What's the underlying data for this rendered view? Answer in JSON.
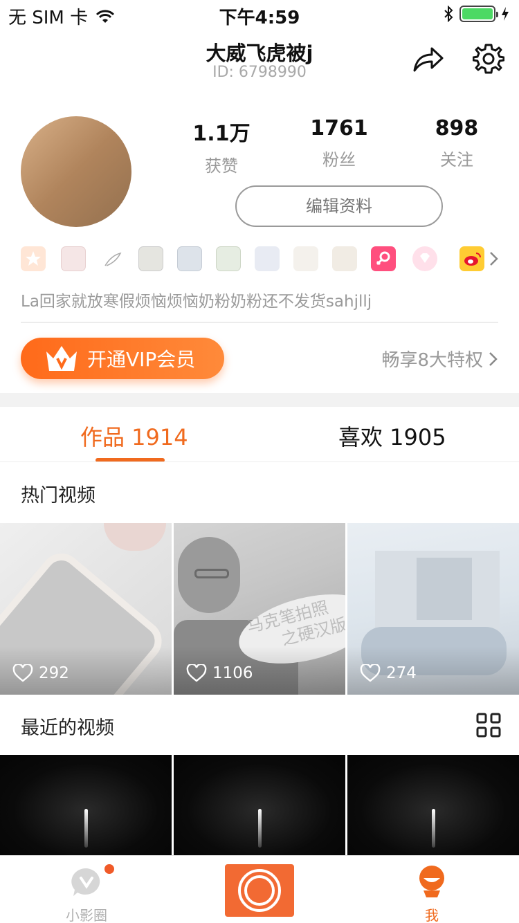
{
  "status_bar": {
    "carrier": "无 SIM 卡",
    "time": "下午4:59"
  },
  "profile": {
    "name": "大威飞虎被j",
    "id": "ID: 6798990",
    "stats": [
      {
        "value": "1.1万",
        "label": "获赞"
      },
      {
        "value": "1761",
        "label": "粉丝"
      },
      {
        "value": "898",
        "label": "关注"
      }
    ],
    "edit_label": "编辑资料",
    "bio": "La回家就放寒假烦恼烦恼奶粉奶粉还不发货sahjllj",
    "badges": [
      "star-badge",
      "sticker-badge",
      "feather-badge",
      "sticker-badge",
      "sticker-badge",
      "sticker-badge",
      "cartoon-badge",
      "sketch-badge",
      "text-badge",
      "female-badge",
      "diamond-badge",
      "weibo-badge"
    ]
  },
  "vip": {
    "button_label": "开通VIP会员",
    "privilege_label": "畅享8大特权"
  },
  "tabs": [
    {
      "label": "作品 1914",
      "active": true
    },
    {
      "label": "喜欢 1905",
      "active": false
    }
  ],
  "sections": {
    "hot": "热门视频",
    "recent": "最近的视频"
  },
  "hot_videos": [
    {
      "likes": "292"
    },
    {
      "likes": "1106"
    },
    {
      "likes": "274"
    }
  ],
  "thumb_overlay_text": [
    "马克笔拍照",
    "之硬汉版"
  ],
  "tabbar": {
    "circle_label": "小影圈",
    "me_label": "我"
  },
  "colors": {
    "accent": "#f06a1e",
    "vip_gradient": "#ff6a1a"
  }
}
